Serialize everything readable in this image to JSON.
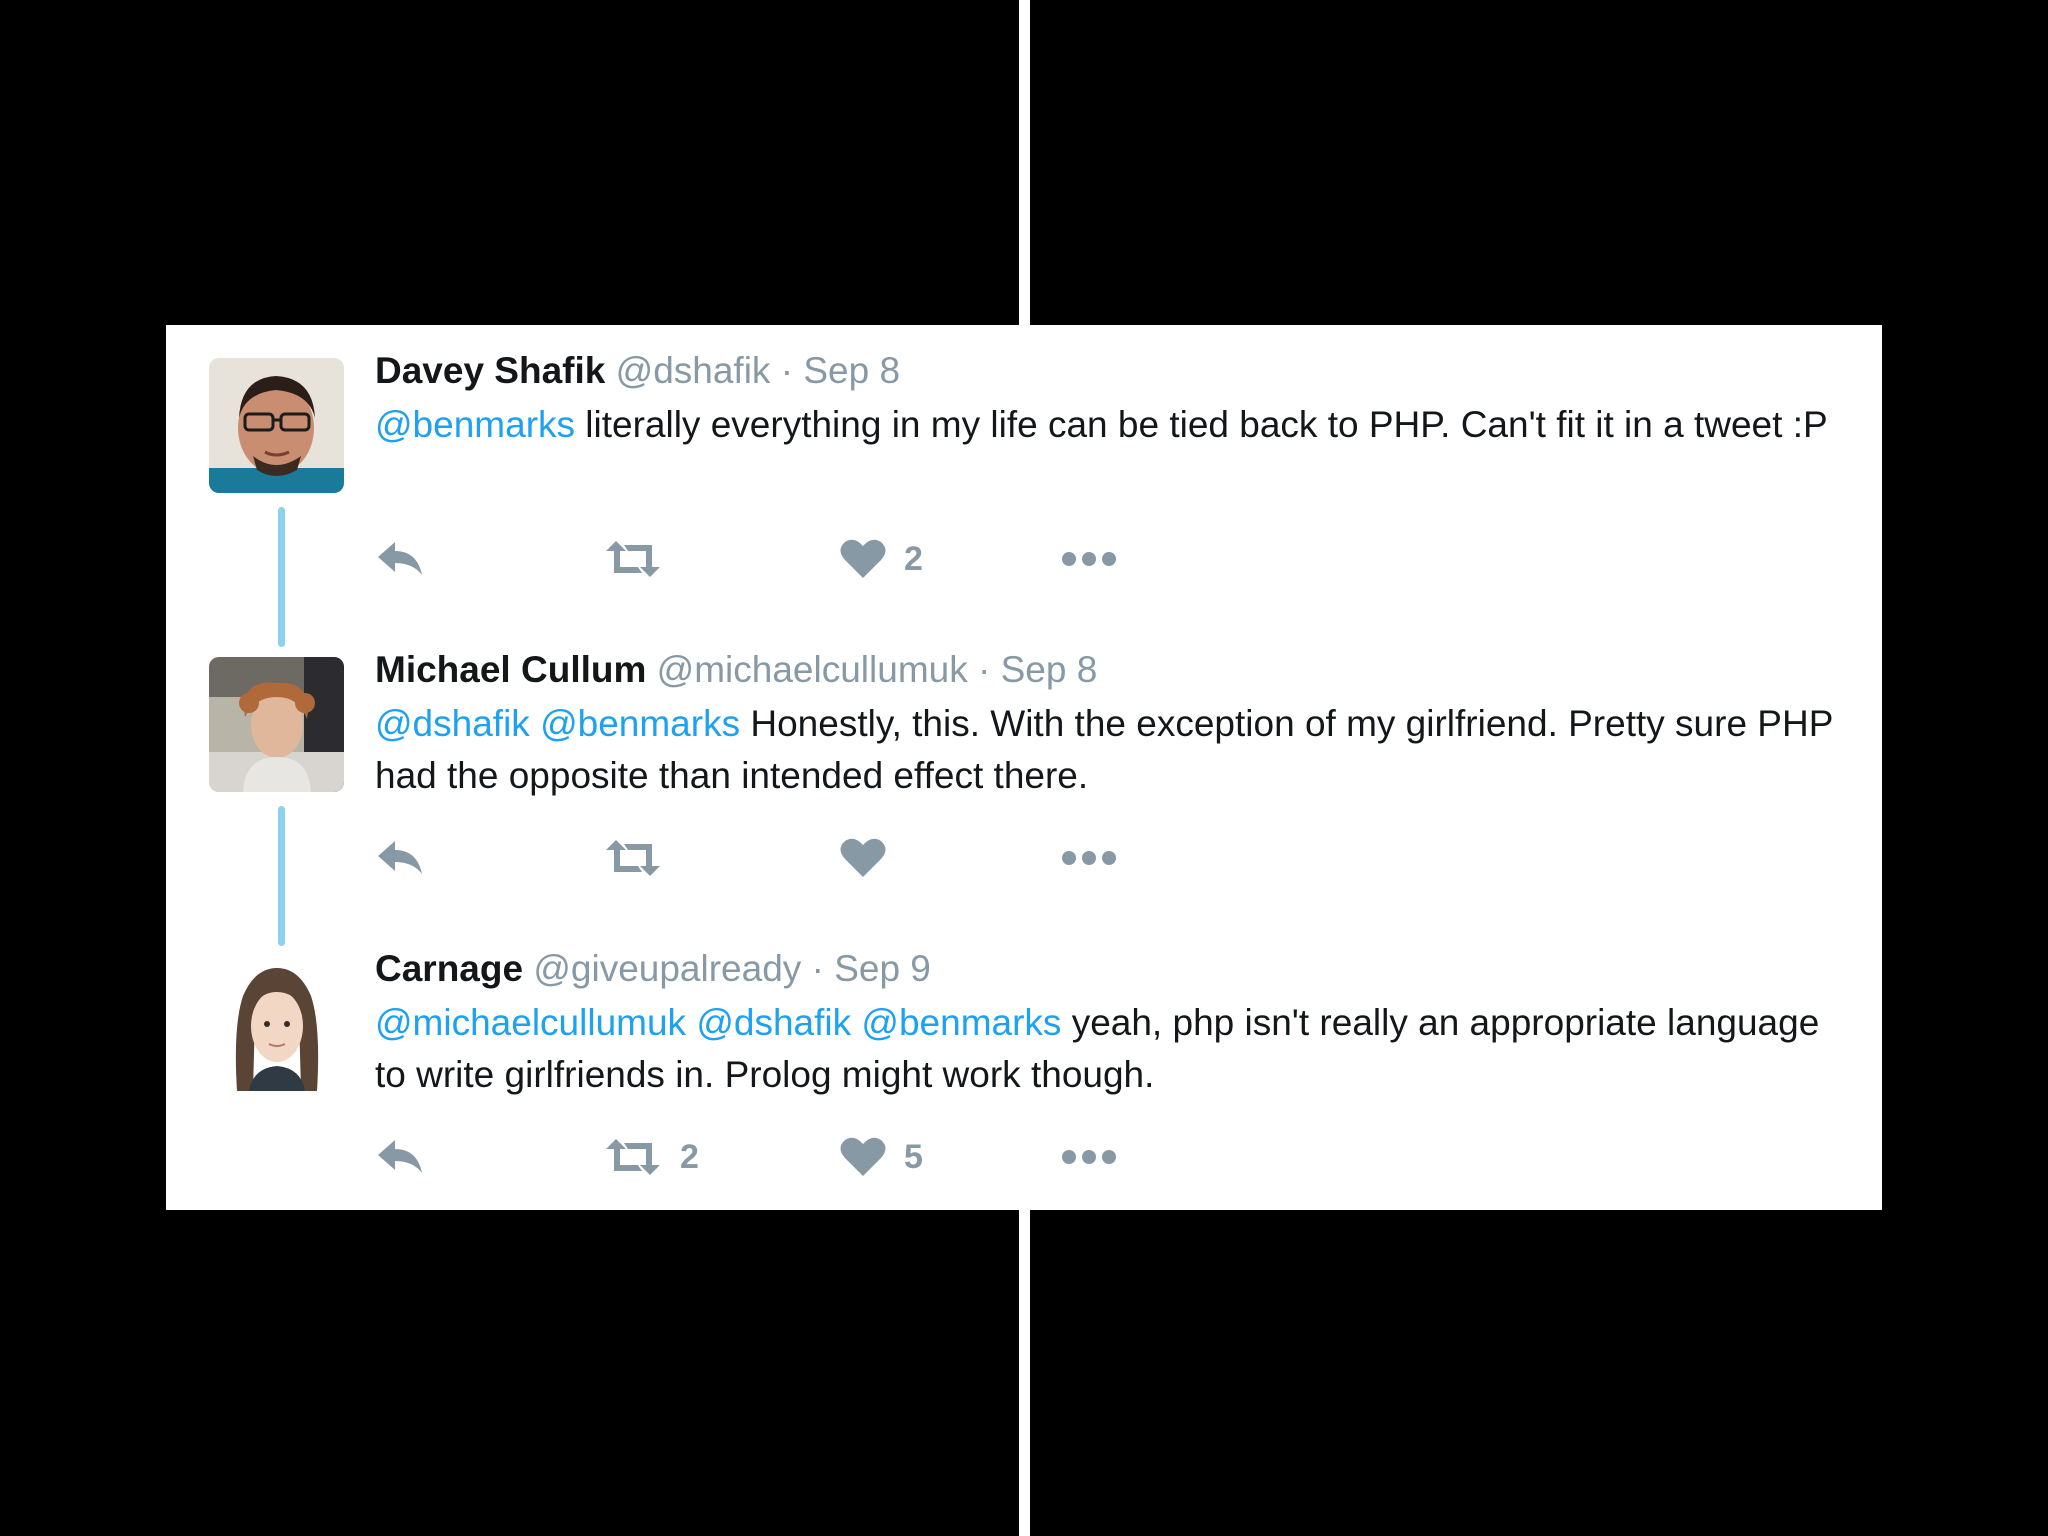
{
  "colors": {
    "background": "#000000",
    "card": "#ffffff",
    "mention": "#1da1f2",
    "muted": "#8899a6",
    "thread_line": "#8ed0ef",
    "text": "#14171a"
  },
  "tweets": [
    {
      "name": "Davey Shafik",
      "handle": "@dshafik",
      "separator": "·",
      "date": "Sep 8",
      "mentions": "@benmarks",
      "text": " literally everything in my life can be tied back to PHP. Can't fit it in a tweet :P",
      "avatar_icon": "avatar-davey-shafik",
      "retweet_count": "",
      "like_count": "2"
    },
    {
      "name": "Michael Cullum",
      "handle": "@michaelcullumuk",
      "separator": "·",
      "date": "Sep 8",
      "mentions": "@dshafik @benmarks",
      "text": " Honestly, this. With the exception of my girlfriend. Pretty sure PHP had the opposite than intended effect there.",
      "avatar_icon": "avatar-michael-cullum",
      "retweet_count": "",
      "like_count": ""
    },
    {
      "name": "Carnage",
      "handle": "@giveupalready",
      "separator": "·",
      "date": "Sep 9",
      "mentions": "@michaelcullumuk @dshafik @benmarks",
      "text": " yeah, php isn't really an appropriate language to write girlfriends in. Prolog might work though.",
      "avatar_icon": "avatar-carnage",
      "retweet_count": "2",
      "like_count": "5"
    }
  ],
  "icons": {
    "reply": "reply-icon",
    "retweet": "retweet-icon",
    "like": "heart-icon",
    "more": "more-icon"
  }
}
